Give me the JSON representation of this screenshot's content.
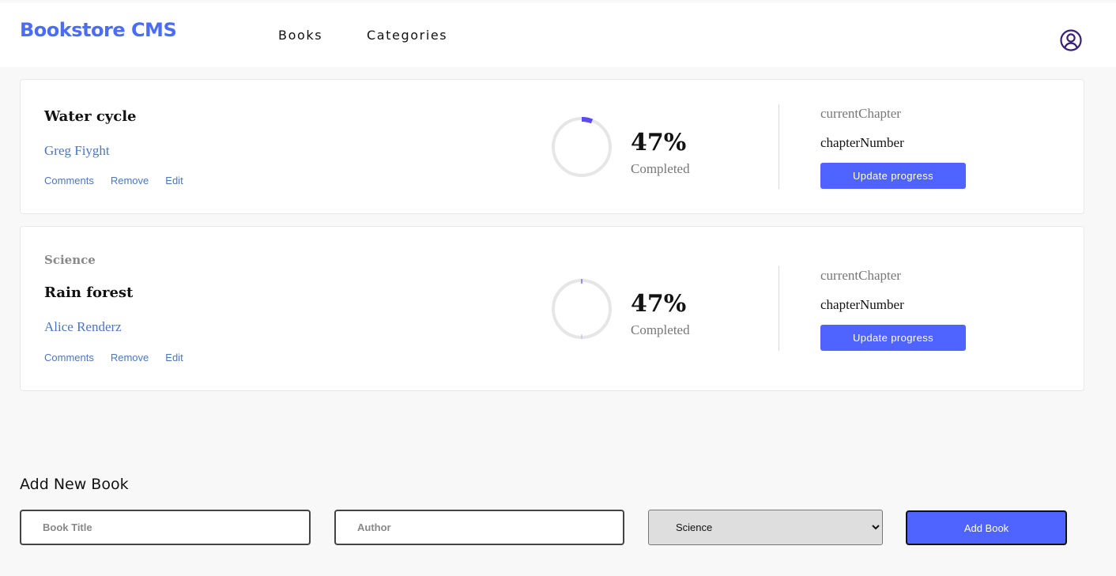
{
  "app": {
    "logo": "Bookstore CMS",
    "nav": [
      {
        "label": "Books"
      },
      {
        "label": "Categories"
      }
    ]
  },
  "books": [
    {
      "category": "",
      "title": "Water cycle",
      "author": "Greg Fiyght",
      "actions": [
        "Comments",
        "Remove",
        "Edit"
      ],
      "progress_percent": 47,
      "progress_label": "47%",
      "completed_label": "Completed",
      "current_chapter_label": "currentChapter",
      "chapter_number": "chapterNumber",
      "update_label": "Update progress"
    },
    {
      "category": "Science",
      "title": "Rain forest",
      "author": "Alice Renderz",
      "actions": [
        "Comments",
        "Remove",
        "Edit"
      ],
      "progress_percent": 47,
      "progress_label": "47%",
      "completed_label": "Completed",
      "current_chapter_label": "currentChapter",
      "chapter_number": "chapterNumber",
      "update_label": "Update progress"
    }
  ],
  "add_book": {
    "heading": "Add New Book",
    "title_placeholder": "Book Title",
    "author_placeholder": "Author",
    "category_selected": "Science",
    "submit_label": "Add Book"
  },
  "colors": {
    "accent": "#4f63ff",
    "logo": "#4a6cf7",
    "link": "#4a76c0",
    "ring_track": "#e6e6e6",
    "ring_arc": "#5a4cf0"
  },
  "icons": {
    "user": "user-circle-icon",
    "select_arrow": "chevron-down-icon"
  }
}
